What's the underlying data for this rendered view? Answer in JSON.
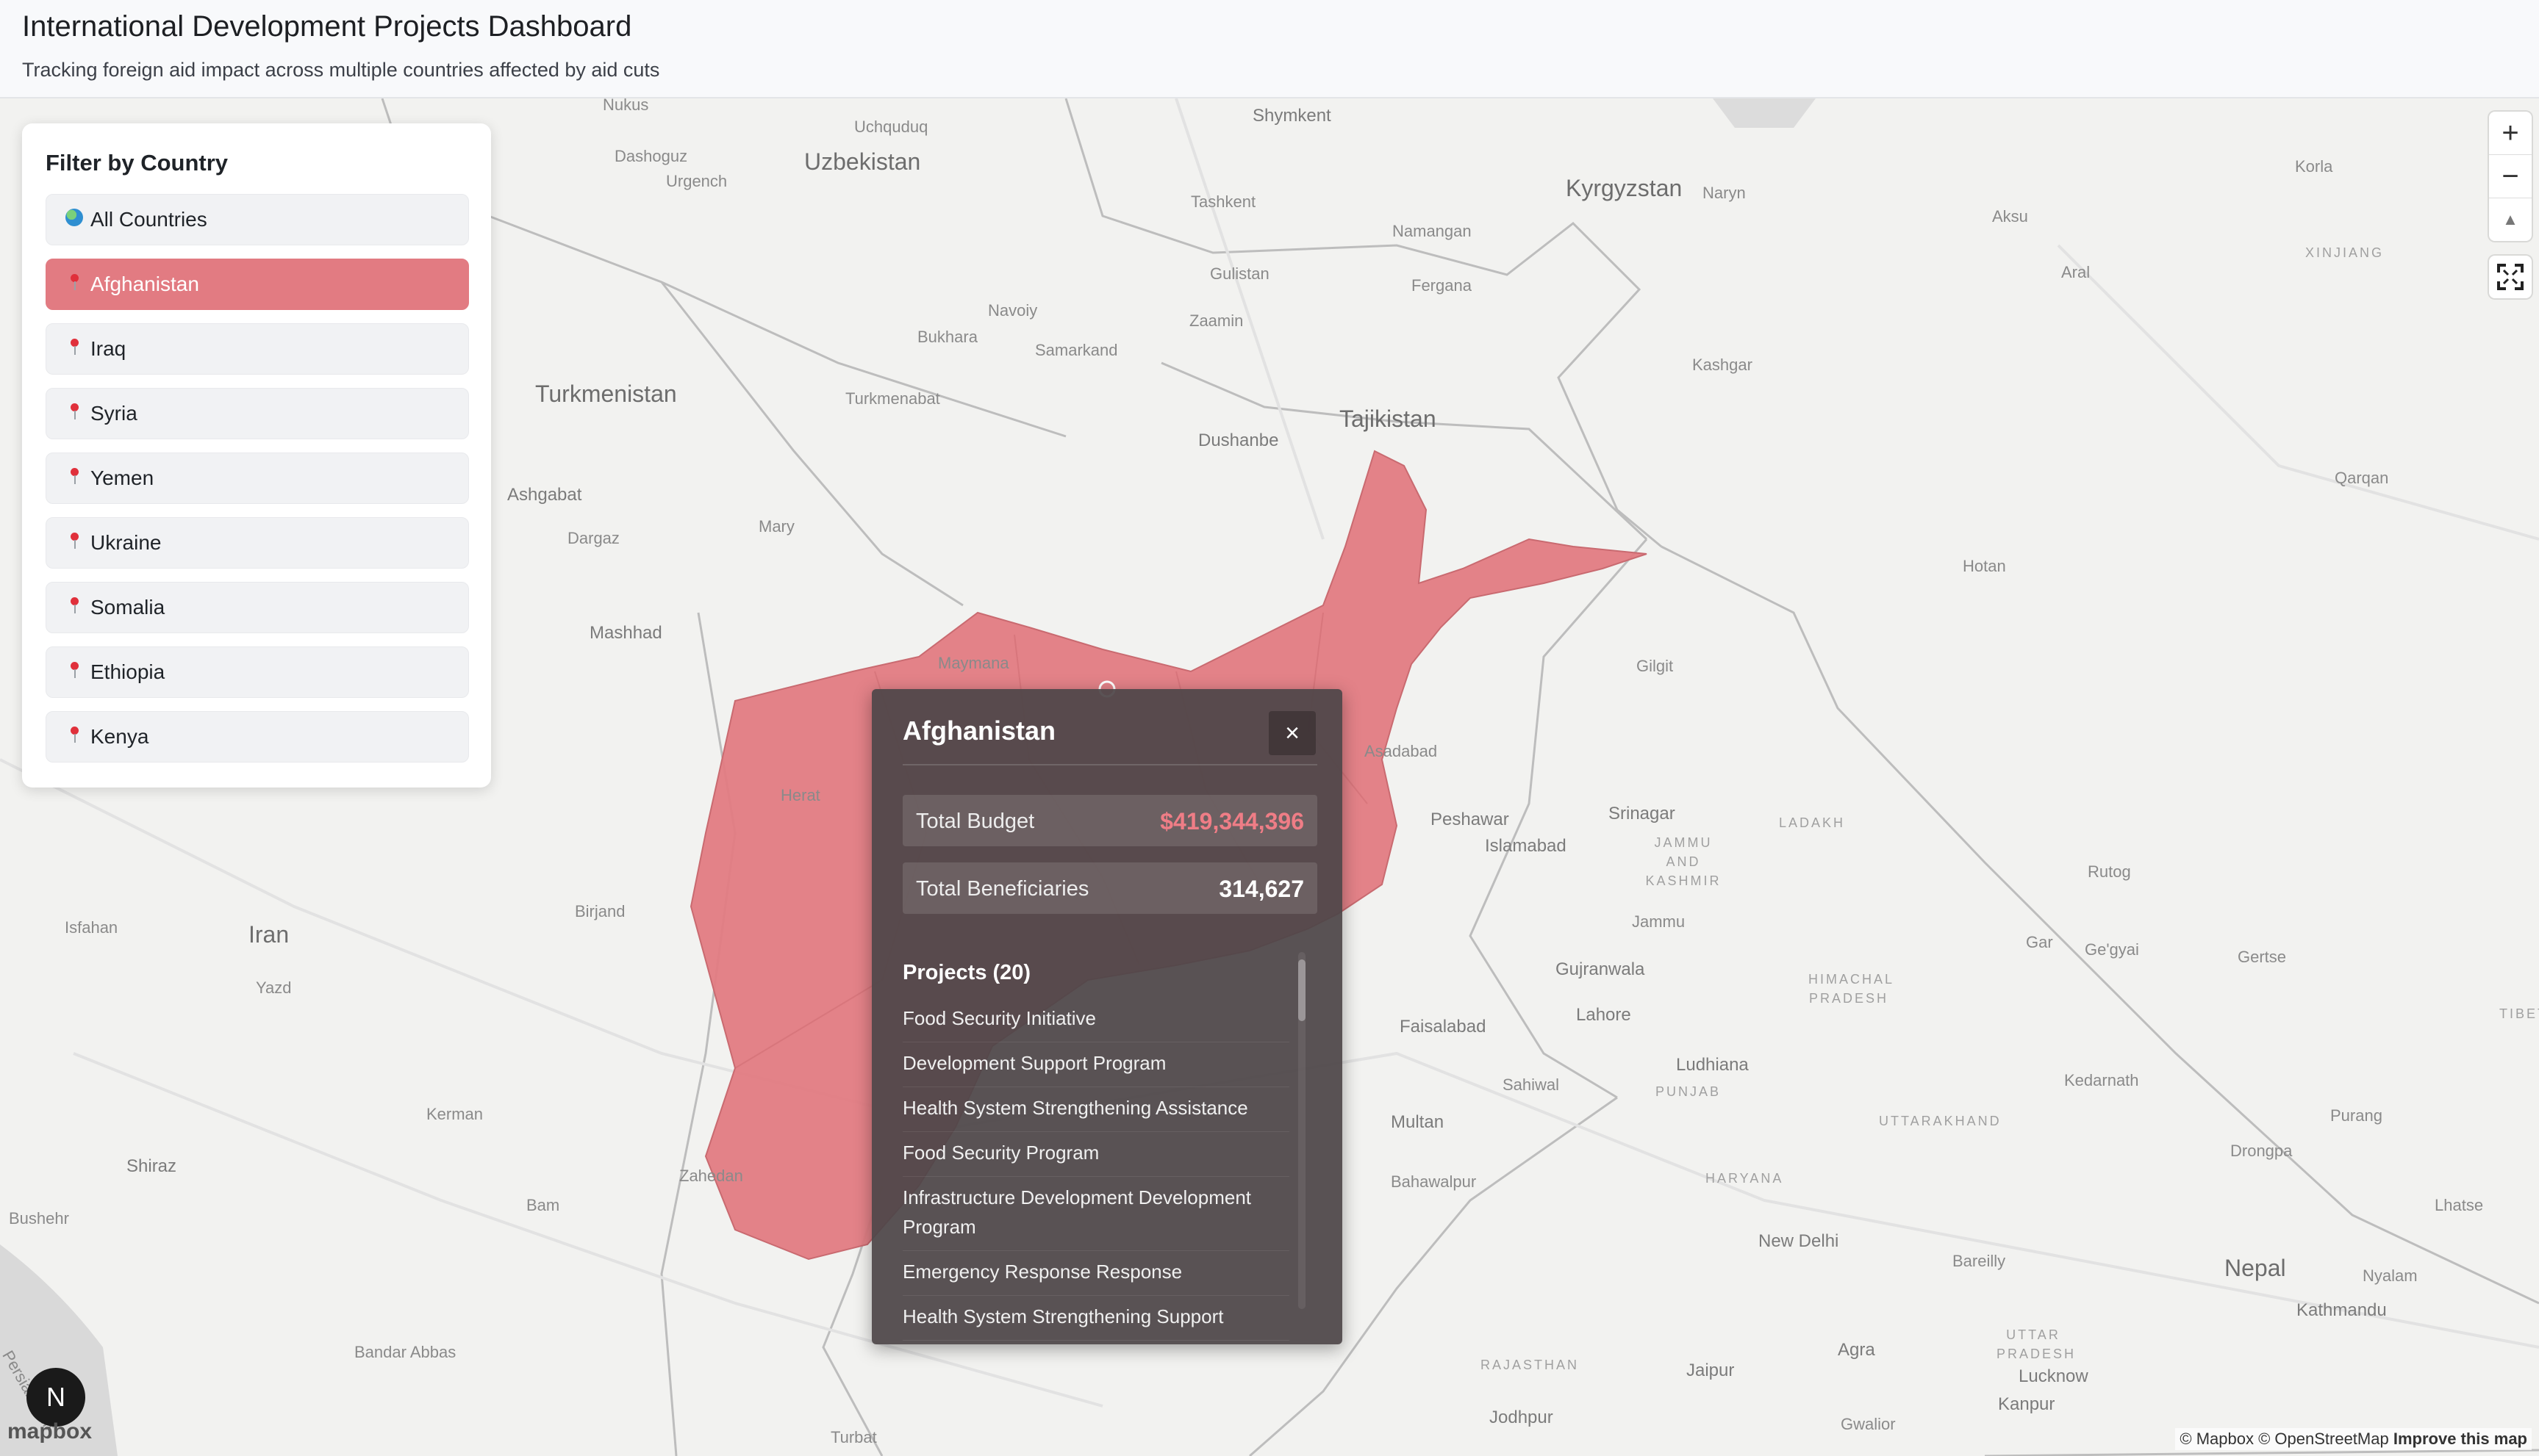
{
  "header": {
    "title": "International Development Projects Dashboard",
    "subtitle": "Tracking foreign aid impact across multiple countries affected by aid cuts"
  },
  "filter": {
    "title": "Filter by Country",
    "items": [
      {
        "label": "All Countries",
        "icon": "globe-icon",
        "active": false
      },
      {
        "label": "Afghanistan",
        "icon": "pin-icon",
        "active": true
      },
      {
        "label": "Iraq",
        "icon": "pin-icon",
        "active": false
      },
      {
        "label": "Syria",
        "icon": "pin-icon",
        "active": false
      },
      {
        "label": "Yemen",
        "icon": "pin-icon",
        "active": false
      },
      {
        "label": "Ukraine",
        "icon": "pin-icon",
        "active": false
      },
      {
        "label": "Somalia",
        "icon": "pin-icon",
        "active": false
      },
      {
        "label": "Ethiopia",
        "icon": "pin-icon",
        "active": false
      },
      {
        "label": "Kenya",
        "icon": "pin-icon",
        "active": false
      }
    ]
  },
  "popup": {
    "country": "Afghanistan",
    "close_symbol": "×",
    "budget_label": "Total Budget",
    "budget_value": "$419,344,396",
    "beneficiaries_label": "Total Beneficiaries",
    "beneficiaries_value": "314,627",
    "projects_header": "Projects (20)",
    "projects": [
      "Food Security Initiative",
      "Development Support Program",
      "Health System Strengthening Assistance",
      "Food Security Program",
      "Infrastructure Development Development Program",
      "Emergency Response Response",
      "Health System Strengthening Support"
    ]
  },
  "map": {
    "highlight_color": "#e27b82",
    "countries": [
      "Uzbekistan",
      "Kyrgyzstan",
      "Turkmenistan",
      "Tajikistan",
      "Iran",
      "Nepal"
    ],
    "cities": [
      "Nukus",
      "Uchquduq",
      "Shymkent",
      "Dashoguz",
      "Urgench",
      "Tashkent",
      "Namangan",
      "Naryn",
      "Korla",
      "Aksu",
      "Gulistan",
      "Fergana",
      "Aral",
      "Navoiy",
      "Bukhara",
      "Zaamin",
      "Samarkand",
      "Kashgar",
      "Turkmenabat",
      "Dushanbe",
      "Ashgabat",
      "Dargaz",
      "Mary",
      "Qarqan",
      "Hotan",
      "Mashhad",
      "Maymana",
      "Gilgit",
      "Herat",
      "Asadabad",
      "Peshawar",
      "Srinagar",
      "Islamabad",
      "Rutog",
      "Isfahan",
      "Birjand",
      "Jammu",
      "Gar",
      "Ge'gyai",
      "Gertse",
      "Yazd",
      "Gujranwala",
      "Faisalabad",
      "Lahore",
      "Ludhiana",
      "Kedarnath",
      "Kerman",
      "Sahiwal",
      "Multan",
      "Purang",
      "Drongpa",
      "Shiraz",
      "Zahedan",
      "Bam",
      "Bahawalpur",
      "Lhatse",
      "Bushehr",
      "New Delhi",
      "Bareilly",
      "Nyalam",
      "Kathmandu",
      "Bandar Abbas",
      "Agra",
      "Jaipur",
      "Lucknow",
      "Kanpur",
      "Jodhpur",
      "Gwalior",
      "Turbat"
    ],
    "regions": [
      "XINJIANG",
      "LADAKH",
      "JAMMU AND KASHMIR",
      "HIMACHAL PRADESH",
      "PUNJAB",
      "UTTARAKHAND",
      "HARYANA",
      "UTTAR PRADESH",
      "RAJASTHAN",
      "TIBET"
    ],
    "water_label": "Persian Gulf",
    "north_label": "N",
    "logo_text": "mapbox"
  },
  "controls": {
    "zoom_in": "+",
    "zoom_out": "−",
    "compass": "▲",
    "fullscreen": "fullscreen-icon"
  },
  "attribution": {
    "text": "© Mapbox © OpenStreetMap",
    "improve": "Improve this map"
  }
}
